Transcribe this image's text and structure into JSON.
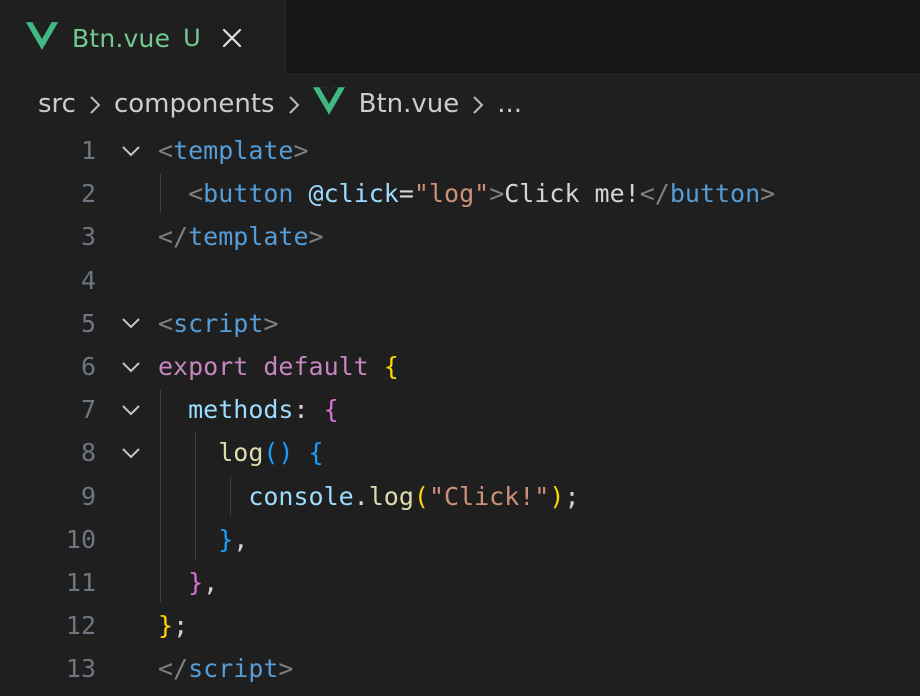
{
  "tab": {
    "icon": "vue-logo-icon",
    "title": "Btn.vue",
    "status": "U",
    "close_icon": "close-icon"
  },
  "breadcrumb": {
    "items": [
      "src",
      "components",
      "Btn.vue",
      "..."
    ],
    "separator_icon": "chevron-right-icon"
  },
  "colors": {
    "tab_text": "#73c991",
    "vue_green": "#41b883",
    "editor_bg": "#1f1f1f",
    "line_number": "#6e7681"
  },
  "editor": {
    "lines": [
      {
        "number": "1",
        "foldable": true,
        "tokens": [
          [
            "<",
            "punct"
          ],
          [
            "template",
            "tag"
          ],
          [
            ">",
            "punct"
          ]
        ]
      },
      {
        "number": "2",
        "foldable": false,
        "tokens": [
          [
            "  ",
            "text"
          ],
          [
            "<",
            "punct"
          ],
          [
            "button",
            "tag"
          ],
          [
            " ",
            "text"
          ],
          [
            "@click",
            "attr"
          ],
          [
            "=",
            "text"
          ],
          [
            "\"log\"",
            "str"
          ],
          [
            ">",
            "punct"
          ],
          [
            "Click me!",
            "text"
          ],
          [
            "</",
            "punct"
          ],
          [
            "button",
            "tag"
          ],
          [
            ">",
            "punct"
          ]
        ]
      },
      {
        "number": "3",
        "foldable": false,
        "tokens": [
          [
            "</",
            "punct"
          ],
          [
            "template",
            "tag"
          ],
          [
            ">",
            "punct"
          ]
        ]
      },
      {
        "number": "4",
        "foldable": false,
        "tokens": []
      },
      {
        "number": "5",
        "foldable": true,
        "tokens": [
          [
            "<",
            "punct"
          ],
          [
            "script",
            "tag"
          ],
          [
            ">",
            "punct"
          ]
        ]
      },
      {
        "number": "6",
        "foldable": true,
        "tokens": [
          [
            "export",
            "kw"
          ],
          [
            " ",
            "text"
          ],
          [
            "default",
            "kw"
          ],
          [
            " ",
            "text"
          ],
          [
            "{",
            "b1"
          ]
        ]
      },
      {
        "number": "7",
        "foldable": true,
        "tokens": [
          [
            "  ",
            "text"
          ],
          [
            "methods",
            "var"
          ],
          [
            ": ",
            "text"
          ],
          [
            "{",
            "b2"
          ]
        ]
      },
      {
        "number": "8",
        "foldable": true,
        "tokens": [
          [
            "    ",
            "text"
          ],
          [
            "log",
            "fn"
          ],
          [
            "()",
            "b3"
          ],
          [
            " ",
            "text"
          ],
          [
            "{",
            "b3"
          ]
        ]
      },
      {
        "number": "9",
        "foldable": false,
        "tokens": [
          [
            "      ",
            "text"
          ],
          [
            "console",
            "var"
          ],
          [
            ".",
            "text"
          ],
          [
            "log",
            "fn"
          ],
          [
            "(",
            "b1"
          ],
          [
            "\"Click!\"",
            "str"
          ],
          [
            ")",
            "b1"
          ],
          [
            ";",
            "text"
          ]
        ]
      },
      {
        "number": "10",
        "foldable": false,
        "tokens": [
          [
            "    ",
            "text"
          ],
          [
            "}",
            "b3"
          ],
          [
            ",",
            "text"
          ]
        ]
      },
      {
        "number": "11",
        "foldable": false,
        "tokens": [
          [
            "  ",
            "text"
          ],
          [
            "}",
            "b2"
          ],
          [
            ",",
            "text"
          ]
        ]
      },
      {
        "number": "12",
        "foldable": false,
        "tokens": [
          [
            "}",
            "b1"
          ],
          [
            ";",
            "text"
          ]
        ]
      },
      {
        "number": "13",
        "foldable": false,
        "tokens": [
          [
            "</",
            "punct"
          ],
          [
            "script",
            "tag"
          ],
          [
            ">",
            "punct"
          ]
        ]
      }
    ]
  }
}
